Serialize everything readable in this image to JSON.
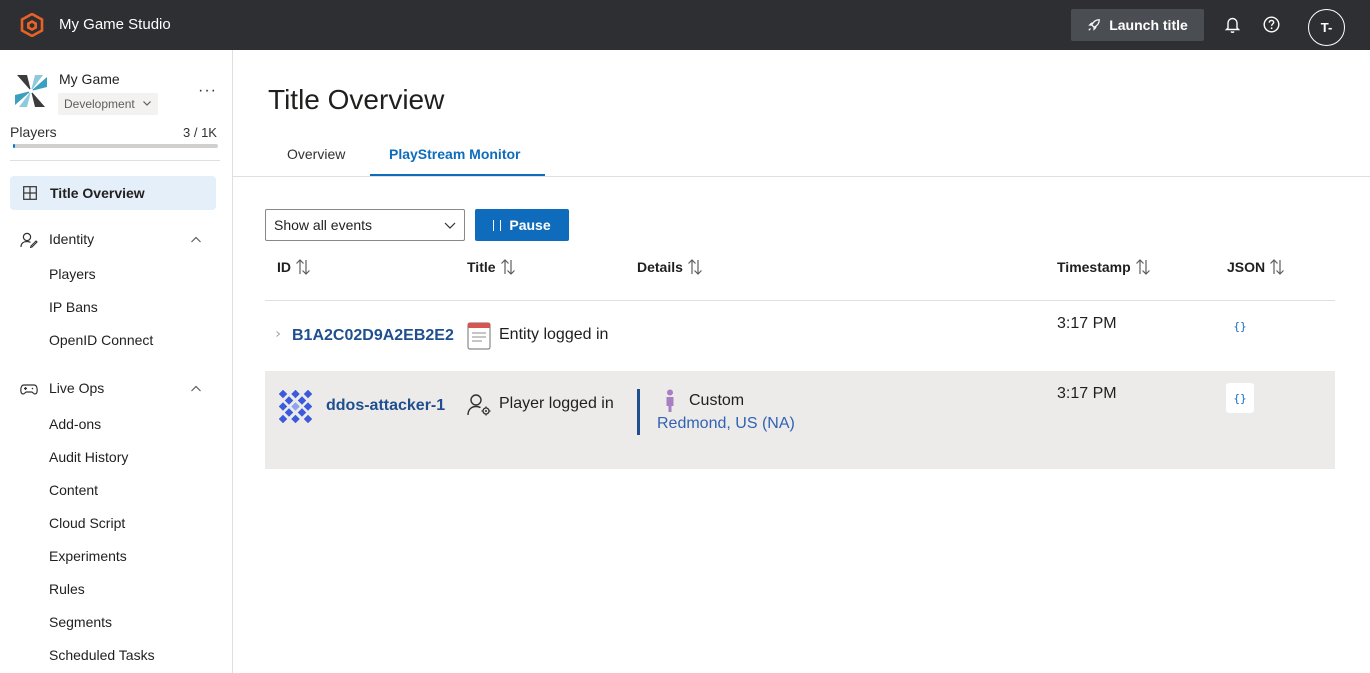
{
  "app": {
    "name": "My Game Studio",
    "launch_label": "Launch title",
    "avatar_initials": "T-"
  },
  "sidebar": {
    "game_name": "My Game",
    "environment": "Development",
    "players_label": "Players",
    "players_count": "3 / 1K",
    "players_fraction": 0.003,
    "more_label": "···",
    "active_item": "Title Overview",
    "groups": [
      {
        "label": "Identity",
        "items": [
          "Players",
          "IP Bans",
          "OpenID Connect"
        ]
      },
      {
        "label": "Live Ops",
        "items": [
          "Add-ons",
          "Audit History",
          "Content",
          "Cloud Script",
          "Experiments",
          "Rules",
          "Segments",
          "Scheduled Tasks"
        ]
      }
    ]
  },
  "main": {
    "title": "Title Overview",
    "tabs": [
      {
        "label": "Overview"
      },
      {
        "label": "PlayStream Monitor"
      }
    ],
    "filter_value": "Show all events",
    "pause_label": "Pause",
    "columns": {
      "id": "ID",
      "title": "Title",
      "details": "Details",
      "timestamp": "Timestamp",
      "json": "JSON"
    },
    "rows": [
      {
        "id": "B1A2C02D9A2EB2E2",
        "title": "Entity logged in",
        "timestamp": "3:17 PM",
        "json": "{}"
      },
      {
        "id": "ddos-attacker-1",
        "title": "Player logged in",
        "detail_primary": "Custom",
        "detail_location": "Redmond, US (NA)",
        "timestamp": "3:17 PM",
        "json": "{}"
      }
    ]
  },
  "colors": {
    "topbar": "#2d2f33",
    "accent": "#0f6cbd",
    "brand_orange": "#ea6126"
  }
}
